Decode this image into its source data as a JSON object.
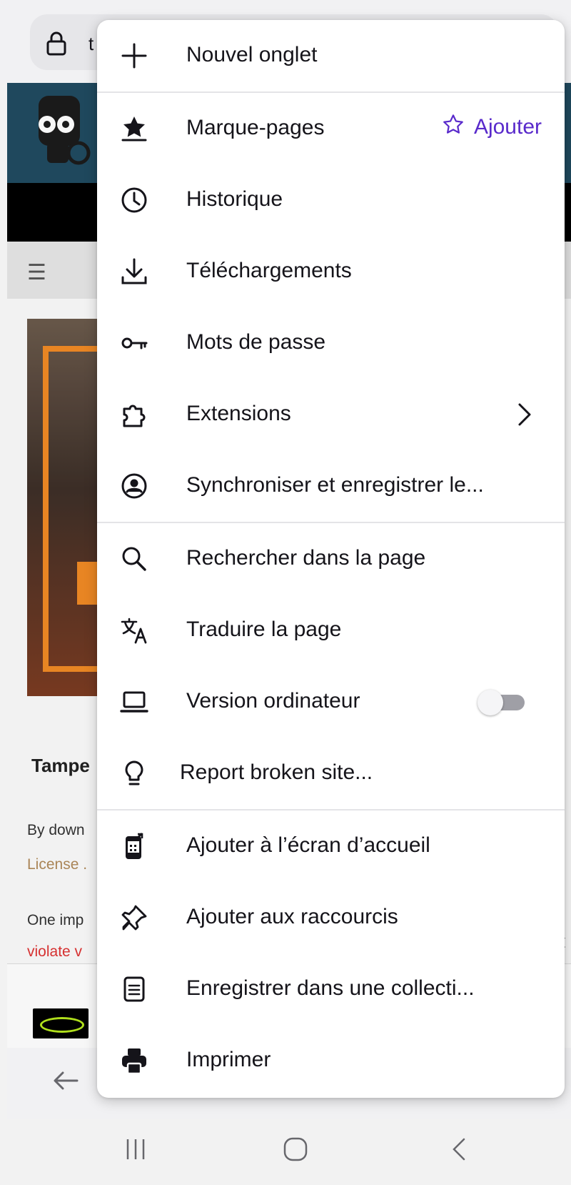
{
  "browser": {
    "url_partial": "t",
    "lock_icon": "lock-icon"
  },
  "page": {
    "article_title_partial": "Tampe",
    "p1_partial": "By down",
    "p2_partial": "License .",
    "p3_partial": "One imp",
    "p4_partial": "violate v"
  },
  "menu": {
    "items": [
      {
        "label": "Nouvel onglet",
        "icon": "plus-icon"
      },
      {
        "label": "Marque-pages",
        "icon": "bookmark-star-icon",
        "action_label": "Ajouter",
        "action_icon": "star-outline-icon"
      },
      {
        "label": "Historique",
        "icon": "clock-icon"
      },
      {
        "label": "Téléchargements",
        "icon": "download-icon"
      },
      {
        "label": "Mots de passe",
        "icon": "key-icon"
      },
      {
        "label": "Extensions",
        "icon": "puzzle-icon"
      },
      {
        "label": "Synchroniser et enregistrer le...",
        "icon": "account-icon"
      },
      {
        "label": "Rechercher dans la page",
        "icon": "search-icon"
      },
      {
        "label": "Traduire la page",
        "icon": "translate-icon"
      },
      {
        "label": "Version ordinateur",
        "icon": "laptop-icon",
        "toggle_on": false
      },
      {
        "label": "Report broken site...",
        "icon": "lightbulb-icon"
      },
      {
        "label": "Ajouter à l’écran d’accueil",
        "icon": "add-to-homescreen-icon"
      },
      {
        "label": "Ajouter aux raccourcis",
        "icon": "pin-icon"
      },
      {
        "label": "Enregistrer dans une collecti...",
        "icon": "collection-icon"
      },
      {
        "label": "Imprimer",
        "icon": "printer-icon"
      }
    ]
  },
  "colors": {
    "accent": "#592acb",
    "text": "#15141a",
    "divider": "#e4e4e7",
    "site_header": "#214b61"
  }
}
